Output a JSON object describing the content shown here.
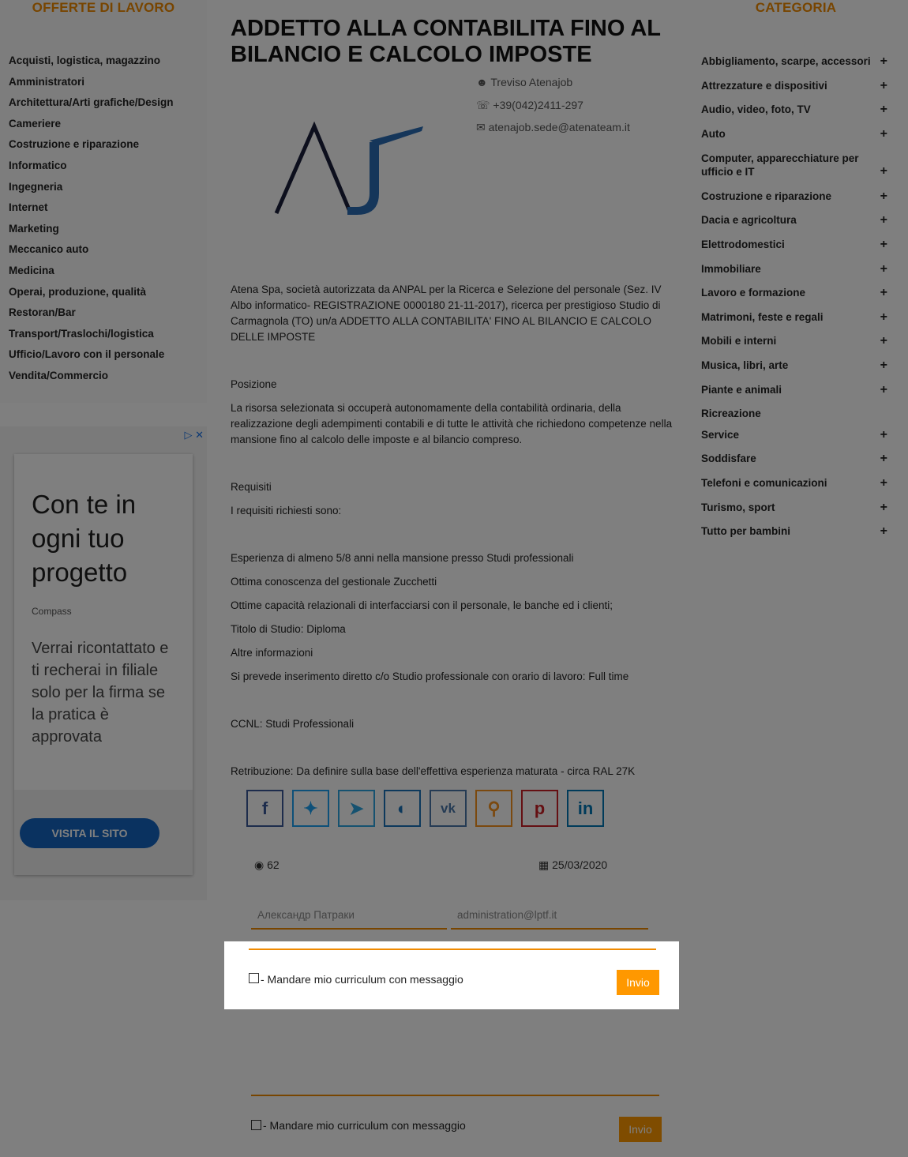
{
  "left_sidebar": {
    "title": "OFFERTE DI LAVORO",
    "items": [
      "Acquisti, logistica, magazzino",
      "Amministratori",
      "Architettura/Arti grafiche/Design",
      "Cameriere",
      "Costruzione e riparazione",
      "Informatico",
      "Ingegneria",
      "Internet",
      "Marketing",
      "Meccanico auto",
      "Medicina",
      "Operai, produzione, qualità",
      "Restoran/Bar",
      "Transport/Traslochi/logistica",
      "Ufficio/Lavoro con il personale",
      "Vendita/Commercio"
    ]
  },
  "ad": {
    "headline": "Con te in ogni tuo progetto",
    "brand": "Compass",
    "body": "Verrai ricontattato e ti recherai in filiale solo per la firma se la pratica è approvata",
    "button": "VISITA IL SITO"
  },
  "job": {
    "title": "ADDETTO ALLA CONTABILITA FINO AL BILANCIO E CALCOLO IMPOSTE",
    "location": "Treviso Atenajob",
    "phone": "+39(042)2411-297",
    "email": "atenajob.sede@atenateam.it",
    "intro": "Atena Spa, società autorizzata da ANPAL per la Ricerca e Selezione del personale (Sez. IV Albo informatico- REGISTRAZIONE 0000180 21-11-2017), ricerca per prestigioso Studio di Carmagnola (TO) un/a ADDETTO ALLA CONTABILITA' FINO AL BILANCIO E CALCOLO DELLE IMPOSTE",
    "position_heading": "Posizione",
    "position_text": "La risorsa selezionata si occuperà autonomamente della contabilità ordinaria, della realizzazione degli adempimenti contabili e di tutte le attività che richiedono competenze nella mansione fino al calcolo delle imposte e al bilancio compreso.",
    "requirements_heading": "Requisiti",
    "requirements_intro": "I requisiti richiesti sono:",
    "req1": "Esperienza di almeno 5/8 anni nella mansione presso Studi professionali",
    "req2": "Ottima conoscenza del gestionale Zucchetti",
    "req3": "Ottime capacità relazionali di interfacciarsi con il personale, le banche ed i clienti;",
    "req4": "Titolo di Studio: Diploma",
    "other_heading": "Altre informazioni",
    "other_text": "Si prevede inserimento diretto c/o Studio professionale con orario di lavoro: Full time",
    "ccnl": "CCNL: Studi Professionali",
    "salary": "Retribuzione: Da definire sulla base dell'effettiva esperienza maturata - circa RAL 27K",
    "views": "62",
    "date": "25/03/2020"
  },
  "form": {
    "name_placeholder": "Александр Патраки",
    "email_placeholder": "administration@lptf.it",
    "checkbox_label": "- Mandare mio curriculum con messaggio",
    "send_label": "Invio"
  },
  "modal": {
    "checkbox_label": "- Mandare mio curriculum con messaggio",
    "send_label": "Invio"
  },
  "right_sidebar": {
    "title": "CATEGORIA",
    "items": [
      "Abbigliamento, scarpe, accessori",
      "Attrezzature e dispositivi",
      "Audio, video, foto, TV",
      "Auto",
      "Computer, apparecchiature per ufficio e IT",
      "Costruzione e riparazione",
      "Dacia e agricoltura",
      "Elettrodomestici",
      "Immobiliare",
      "Lavoro e formazione",
      "Matrimoni, feste e regali",
      "Mobili e interni",
      "Musica, libri, arte",
      "Piante e animali",
      "Ricreazione",
      "Service",
      "Soddisfare",
      "Telefoni e comunicazioni",
      "Turismo, sport",
      "Tutto per bambini"
    ]
  },
  "share_colors": {
    "facebook": "#3b5998",
    "twitter": "#1da1f2",
    "telegram": "#2ca5e0",
    "livejournal": "#1a73b8",
    "vk": "#4a76a8",
    "odnoklassniki": "#f7931e",
    "pinterest": "#cb2027",
    "linkedin": "#0077b5"
  },
  "accent_color": "#f08a00"
}
